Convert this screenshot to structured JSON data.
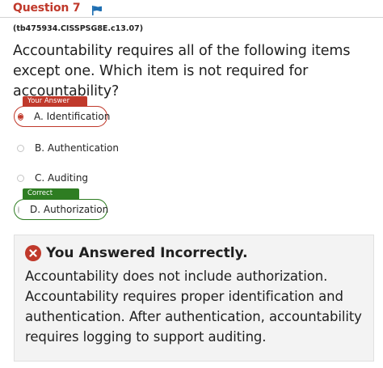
{
  "question": {
    "title": "Question 7",
    "id_label": "(tb475934.CISSPSG8E.c13.07)",
    "text": "Accountability requires all of the following items except one. Which item is not required for accountability?"
  },
  "tags": {
    "your_answer": "Your Answer",
    "correct": "Correct"
  },
  "options": [
    {
      "label": "A. Identification",
      "selected": true
    },
    {
      "label": "B. Authentication",
      "selected": false
    },
    {
      "label": "C. Auditing",
      "selected": false
    },
    {
      "label": "D. Authorization",
      "selected": false
    }
  ],
  "feedback": {
    "title": "You Answered Incorrectly.",
    "body": "Accountability does not include authorization. Accountability requires proper identification and authentication. After authentication, accountability requires logging to support auditing."
  },
  "colors": {
    "accent_red": "#c0392b",
    "correct_green": "#2e7d22",
    "flag_blue": "#1f6fb2"
  },
  "icons": [
    "flag-icon",
    "incorrect-x-icon"
  ]
}
